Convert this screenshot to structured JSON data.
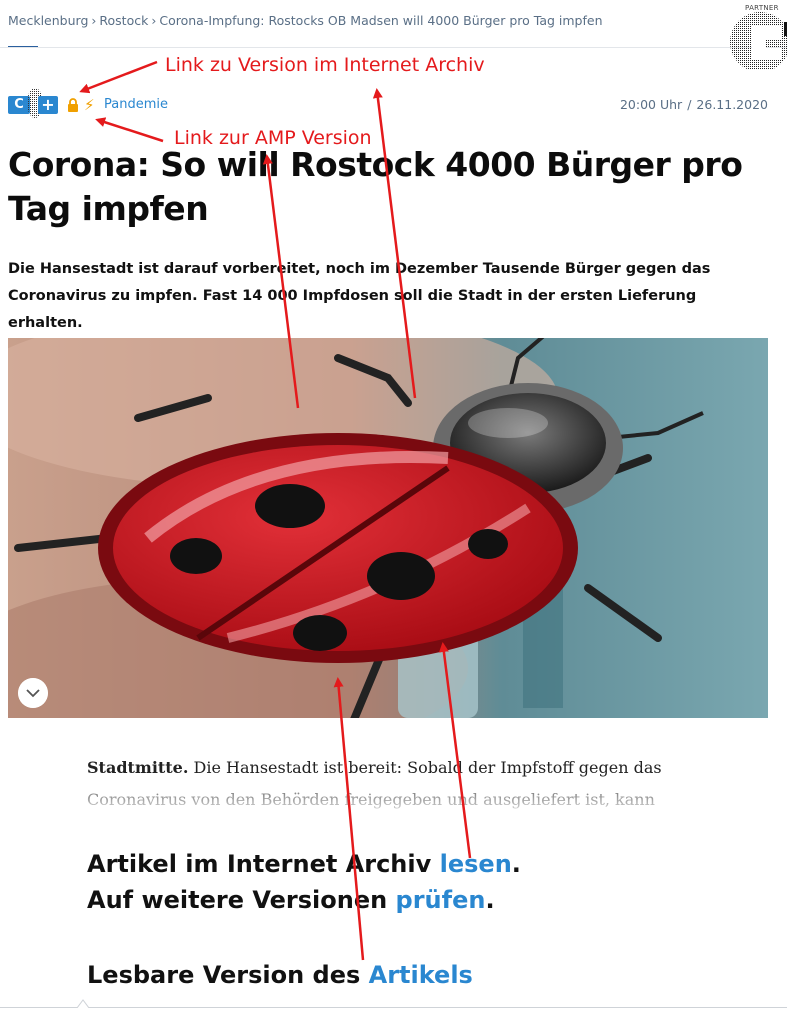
{
  "breadcrumb": {
    "items": [
      "Mecklenburg",
      "Rostock",
      "Corona-Impfung: Rostocks OB Madsen will 4000 Bürger pro Tag impfen"
    ],
    "separator": "›"
  },
  "partner_label": "PARTNER",
  "meta": {
    "plus_letter": "C",
    "plus_sign": "+",
    "topic": "Pandemie",
    "time": "20:00 Uhr",
    "date_separator": "/",
    "date": "26.11.2020"
  },
  "article": {
    "headline": "Corona: So will Rostock 4000 Bürger pro Tag impfen",
    "teaser": "Die Hansestadt ist darauf vorbereitet, noch im Dezember Tausende Bürger gegen das Coronavirus zu impfen. Fast 14 000 Impfdosen soll die Stadt in der ersten Lieferung erhalten.",
    "body_lead": "Stadtmitte.",
    "body_text": " Die Hansestadt ist bereit: Sobald der Impfstoff gegen das Coronavirus von den Behörden freigegeben und ausgeliefert ist, kann"
  },
  "archive_box": {
    "line1_prefix": "Artikel im Internet Archiv ",
    "line1_link": "lesen",
    "line1_suffix": ".",
    "line2_prefix": "Auf weitere Versionen ",
    "line2_link": "prüfen",
    "line2_suffix": ".",
    "readable_prefix": "Lesbare Version des ",
    "readable_link": "Artikels"
  },
  "annotations": {
    "archive_note": "Link zu Version im Internet Archiv",
    "amp_note": "Link zur AMP Version"
  },
  "icons": [
    "chevron-down-icon",
    "lock-icon",
    "lightning-icon",
    "ladybug-icon",
    "partner-logo-icon"
  ],
  "colors": {
    "link": "#2a87d0",
    "annotation": "#e41a1c",
    "lock": "#f0a000",
    "ladybug_red": "#c8101a"
  }
}
